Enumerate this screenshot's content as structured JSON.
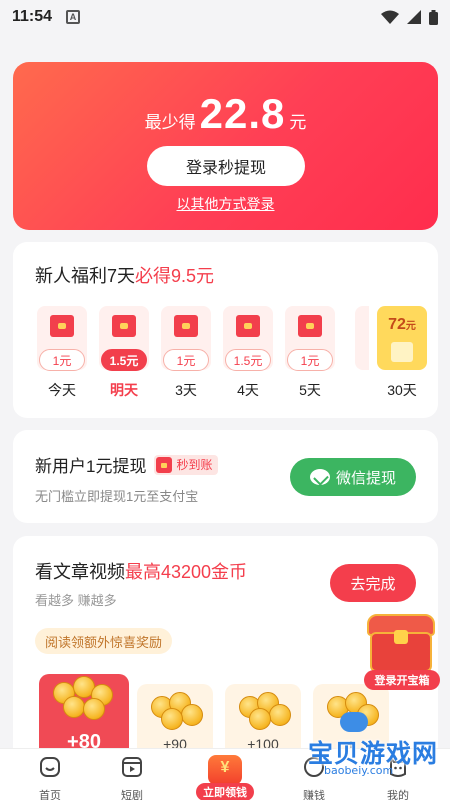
{
  "status_bar": {
    "time": "11:54",
    "a_icon": "A"
  },
  "hero": {
    "prefix": "最少得",
    "amount": "22.8",
    "unit": "元",
    "login_button": "登录秒提现",
    "alt_login": "以其他方式登录"
  },
  "newbie": {
    "title_part1": "新人福利",
    "title_days": "7天",
    "title_part2": "必得",
    "title_amount": "9.5元",
    "days": [
      {
        "amount": "1元",
        "label": "今天",
        "active": false
      },
      {
        "amount": "1.5元",
        "label": "明天",
        "active": true
      },
      {
        "amount": "1元",
        "label": "3天",
        "active": false
      },
      {
        "amount": "1.5元",
        "label": "4天",
        "active": false
      },
      {
        "amount": "1元",
        "label": "5天",
        "active": false
      }
    ],
    "final": {
      "value": "72",
      "unit": "元",
      "label": "30天"
    }
  },
  "new_user": {
    "title": "新用户1元提现",
    "badge": "秒到账",
    "subtitle": "无门槛立即提现1元至支付宝",
    "wechat_button": "微信提现"
  },
  "article": {
    "title_part1": "看文章视频",
    "title_highlight": "最高43200金币",
    "subtitle": "看越多 赚越多",
    "todo_button": "去完成",
    "reading_tag": "阅读领额外惊喜奖励",
    "rewards": [
      "+80",
      "+90",
      "+100",
      "+"
    ]
  },
  "treasure": {
    "label": "登录开宝箱"
  },
  "nav": {
    "home": "首页",
    "short_drama": "短剧",
    "center": "立即领钱",
    "tasks": "赚钱",
    "mine": "我的"
  },
  "watermark": {
    "text": "宝贝游戏网",
    "url": "baobeiy.com"
  }
}
